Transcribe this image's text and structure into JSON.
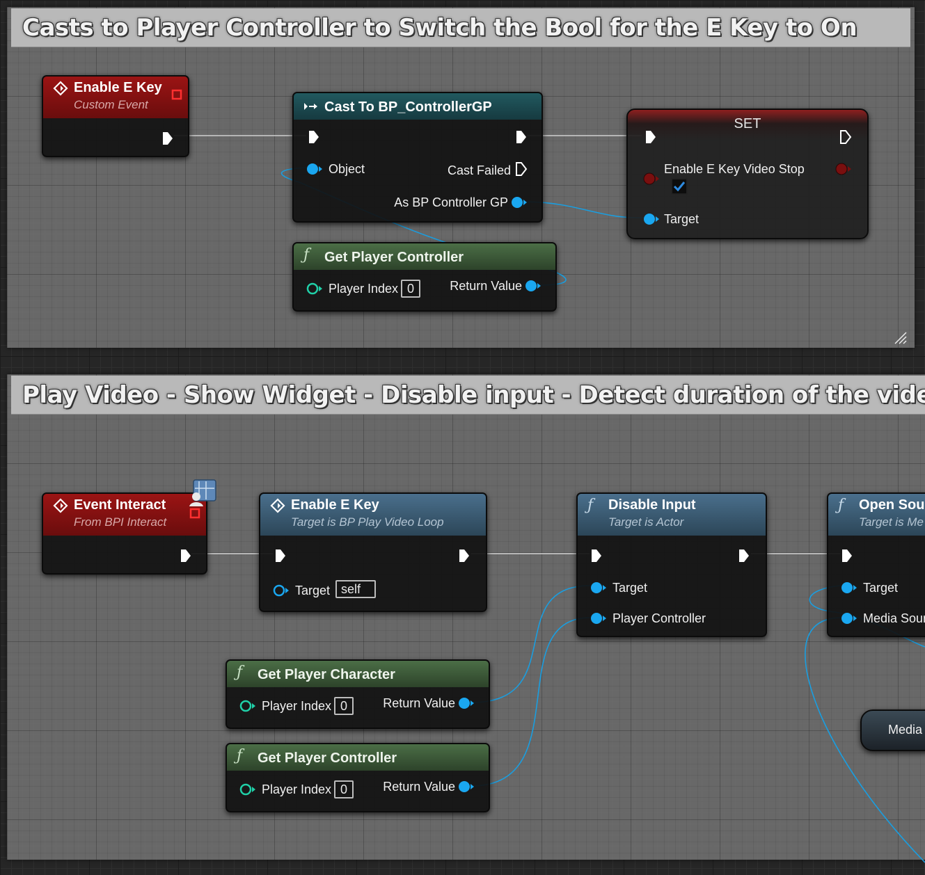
{
  "colors": {
    "exec_pin": "#ffffff",
    "object_pin": "#1aa7f0",
    "bool_pin": "#8a1010",
    "event_header": "#8b1212",
    "cast_header": "#1f5a60",
    "pure_function_header": "#496b44",
    "function_header": "#45698a",
    "comment_title_bg": "#b9b9b9",
    "comment_bg": "#7a7a7a"
  },
  "comment_top": {
    "title": "Casts to Player Controller to Switch the Bool for the E Key to On",
    "nodes": {
      "custom_event": {
        "title": "Enable E Key",
        "subtitle": "Custom Event",
        "icon": "event-diamond-icon"
      },
      "cast": {
        "title": "Cast To BP_ControllerGP",
        "icon": "cast-arrow-icon",
        "pin_object": "Object",
        "pin_cast_failed": "Cast Failed",
        "pin_as": "As BP Controller GP"
      },
      "set": {
        "title": "SET",
        "pin_var": "Enable E Key Video Stop",
        "pin_target": "Target",
        "checkbox_checked": true
      },
      "get_player_controller": {
        "title": "Get Player Controller",
        "icon": "function-icon",
        "pin_player_index": "Player Index",
        "player_index_value": "0",
        "pin_return": "Return Value"
      }
    }
  },
  "comment_bottom": {
    "title": "Play Video - Show Widget - Disable input - Detect duration of the video",
    "nodes": {
      "event_interact": {
        "title": "Event Interact",
        "subtitle": "From BPI Interact",
        "badge_icon": "interface-message-icon"
      },
      "enable_e_key": {
        "title": "Enable E Key",
        "subtitle": "Target is BP Play Video Loop",
        "pin_target": "Target",
        "target_value": "self"
      },
      "disable_input": {
        "title": "Disable Input",
        "subtitle": "Target is Actor",
        "pin_target": "Target",
        "pin_player_controller": "Player Controller"
      },
      "open_source": {
        "title": "Open Sour",
        "subtitle": "Target is Me",
        "pin_target": "Target",
        "pin_media_source": "Media Sour"
      },
      "get_player_character": {
        "title": "Get Player Character",
        "pin_player_index": "Player Index",
        "player_index_value": "0",
        "pin_return": "Return Value"
      },
      "get_player_controller": {
        "title": "Get Player Controller",
        "pin_player_index": "Player Index",
        "player_index_value": "0",
        "pin_return": "Return Value"
      },
      "media_var": {
        "label": "Media"
      }
    }
  }
}
